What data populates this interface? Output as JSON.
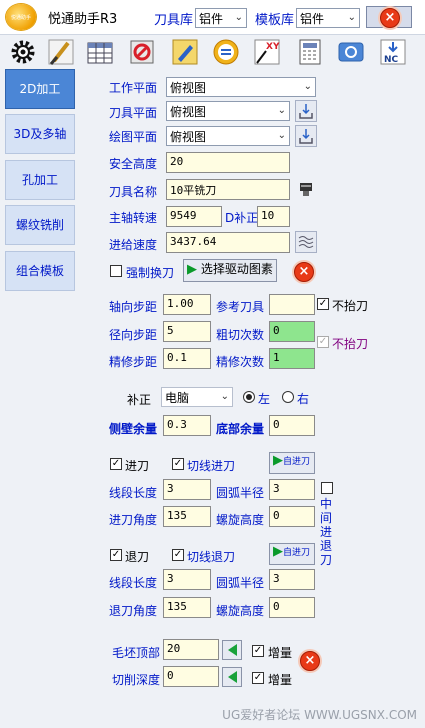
{
  "app": {
    "title": "悦通助手R3",
    "logo_text": "悦通助手"
  },
  "header": {
    "tool_lib_label": "刀具库",
    "tool_lib_value": "铝件",
    "template_lib_label": "模板库",
    "template_lib_value": "铝件"
  },
  "toolbar": [
    "settings-icon",
    "brush-icon",
    "table-icon",
    "no-sign-icon",
    "edit-icon",
    "currency-icon",
    "xy-graph-icon",
    "calculator-icon",
    "card-icon",
    "nc-export-icon"
  ],
  "nav": [
    {
      "label": "2D加工",
      "active": true
    },
    {
      "label": "3D及多轴",
      "active": false
    },
    {
      "label": "孔加工",
      "active": false
    },
    {
      "label": "螺纹铣削",
      "active": false
    },
    {
      "label": "组合模板",
      "active": false
    }
  ],
  "form": {
    "work_plane_label": "工作平面",
    "work_plane_value": "俯视图",
    "tool_plane_label": "刀具平面",
    "tool_plane_value": "俯视图",
    "draw_plane_label": "绘图平面",
    "draw_plane_value": "俯视图",
    "safe_height_label": "安全高度",
    "safe_height_value": "20",
    "tool_name_label": "刀具名称",
    "tool_name_value": "10平铣刀",
    "spindle_label": "主轴转速",
    "spindle_value": "9549",
    "d_comp_label": "D补正",
    "d_comp_value": "10",
    "feed_label": "进给速度",
    "feed_value": "3437.64",
    "force_change_label": "强制换刀",
    "select_driver_label": "选择驱动图素",
    "axial_step_label": "轴向步距",
    "axial_step_value": "1.00",
    "ref_tool_label": "参考刀具",
    "ref_tool_value": "",
    "no_lift_label": "不抬刀",
    "radial_step_label": "径向步距",
    "radial_step_value": "5",
    "rough_count_label": "粗切次数",
    "rough_count_value": "0",
    "no_lift2_label": "不抬刀",
    "finish_step_label": "精修步距",
    "finish_step_value": "0.1",
    "finish_count_label": "精修次数",
    "finish_count_value": "1",
    "comp_label": "补正",
    "comp_value": "电脑",
    "left_label": "左",
    "right_label": "右",
    "side_stock_label": "侧壁余量",
    "side_stock_value": "0.3",
    "bottom_stock_label": "底部余量",
    "bottom_stock_value": "0",
    "lead_in_label": "进刀",
    "tangent_in_label": "切线进刀",
    "auto_in_label": "自进刀",
    "seg_len_label": "线段长度",
    "seg_len_value": "3",
    "arc_r_label": "圆弧半径",
    "arc_r_value": "3",
    "in_angle_label": "进刀角度",
    "in_angle_value": "135",
    "helix_h_label": "螺旋高度",
    "helix_h_value": "0",
    "mid_in_label": "中间进退刀",
    "lead_out_label": "退刀",
    "tangent_out_label": "切线退刀",
    "auto_out_label": "自进刀",
    "seg_len2_label": "线段长度",
    "seg_len2_value": "3",
    "arc_r2_label": "圆弧半径",
    "arc_r2_value": "3",
    "out_angle_label": "退刀角度",
    "out_angle_value": "135",
    "helix_h2_label": "螺旋高度",
    "helix_h2_value": "0",
    "blank_top_label": "毛坯顶部",
    "blank_top_value": "20",
    "increment_label": "增量",
    "cut_depth_label": "切削深度",
    "cut_depth_value": "0",
    "increment2_label": "增量"
  },
  "footer": "UG爱好者论坛 WWW.UGSNX.COM",
  "colors": {
    "label_blue": "#0018c8",
    "nav_active": "#4b86d6",
    "close_red": "#e83a17",
    "count_green": "#8ee58e"
  }
}
